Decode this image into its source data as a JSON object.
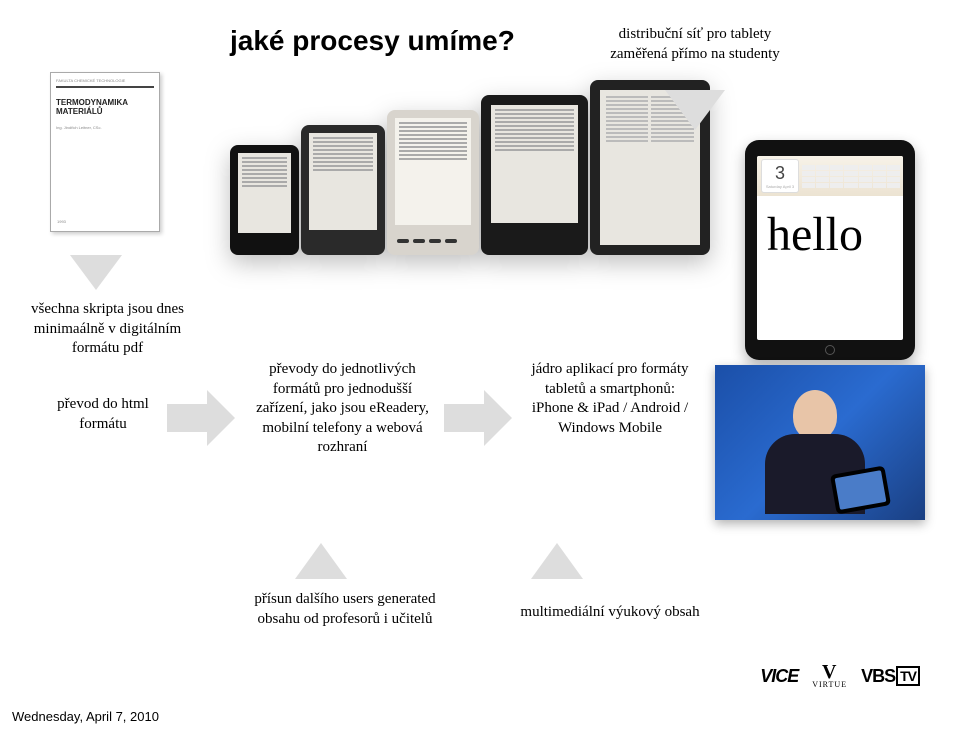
{
  "title": "jaké procesy umíme?",
  "labels": {
    "top_right": "distribuční síť pro tablety zaměřená přímo na studenty",
    "left_caption": "všechna skripta jsou dnes minimaálně v digitálním formátu pdf",
    "mid1": "převod do html formátu",
    "mid2": "převody do jednotlivých formátů pro jednodušší zařízení, jako jsou eReadery, mobilní telefony a webová rozhraní",
    "mid3": "jádro aplikací pro formáty tabletů a smartphonů: iPhone & iPad / Android / Windows Mobile",
    "bot1": "přísun dalšího users generated obsahu od profesorů i učitelů",
    "bot2": "multimediální výukový obsah"
  },
  "book": {
    "faculty": "FAKULTA CHEMICKÉ TECHNOLOGIE",
    "title": "TERMODYNAMIKA MATERIÁLŮ",
    "author": "Ing. Jindřich Leitner, CSc."
  },
  "ipad": {
    "day_number": "3",
    "day_text": "Saturday April 3",
    "hello": "hello"
  },
  "footer": {
    "vice": "VICE",
    "virtue": "VIRTUE",
    "vbs": "VBS",
    "tv": "TV"
  },
  "datestamp": "Wednesday, April 7, 2010"
}
